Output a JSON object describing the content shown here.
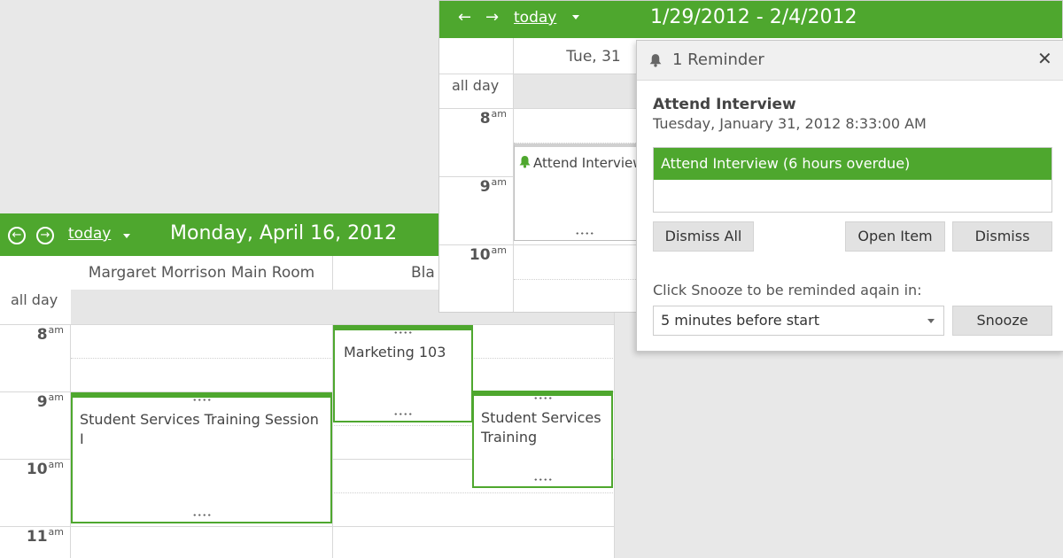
{
  "day_calendar": {
    "nav": {
      "prev_icon": "arrow-left-circle-icon",
      "next_icon": "arrow-right-circle-icon",
      "today_label": "today"
    },
    "title": "Monday, April 16, 2012",
    "columns": [
      "Margaret Morrison Main Room",
      "Bla"
    ],
    "all_day_label": "all day",
    "times": [
      {
        "hour": "8",
        "suffix": "am"
      },
      {
        "hour": "9",
        "suffix": "am"
      },
      {
        "hour": "10",
        "suffix": "am"
      },
      {
        "hour": "11",
        "suffix": "am"
      }
    ],
    "events": [
      {
        "title": "Student Services Training Session I"
      },
      {
        "title": "Marketing 103"
      },
      {
        "title": "Student Services Training"
      }
    ]
  },
  "week_calendar": {
    "nav": {
      "prev_icon": "arrow-left-icon",
      "next_icon": "arrow-right-icon",
      "today_label": "today"
    },
    "title": "1/29/2012 - 2/4/2012",
    "column_header": "Tue, 31",
    "all_day_label": "all day",
    "times": [
      {
        "hour": "8",
        "suffix": "am"
      },
      {
        "hour": "9",
        "suffix": "am"
      },
      {
        "hour": "10",
        "suffix": "am"
      }
    ],
    "event": {
      "title": "Attend Interview",
      "icon": "bell-icon"
    }
  },
  "reminder": {
    "title": "1 Reminder",
    "title_icon": "bell-icon",
    "close_icon": "close-icon",
    "subject": "Attend Interview",
    "datetime": "Tuesday, January 31, 2012 8:33:00 AM",
    "list_items": [
      "Attend Interview (6 hours overdue)"
    ],
    "buttons": {
      "dismiss_all": "Dismiss All",
      "open_item": "Open Item",
      "dismiss": "Dismiss",
      "snooze": "Snooze"
    },
    "snooze_prompt": "Click Snooze to be reminded aqain in:",
    "snooze_option": "5 minutes before start"
  },
  "colors": {
    "accent": "#4ea72e",
    "background": "#e8e8e8",
    "allday_strip": "#e6e6e6"
  }
}
